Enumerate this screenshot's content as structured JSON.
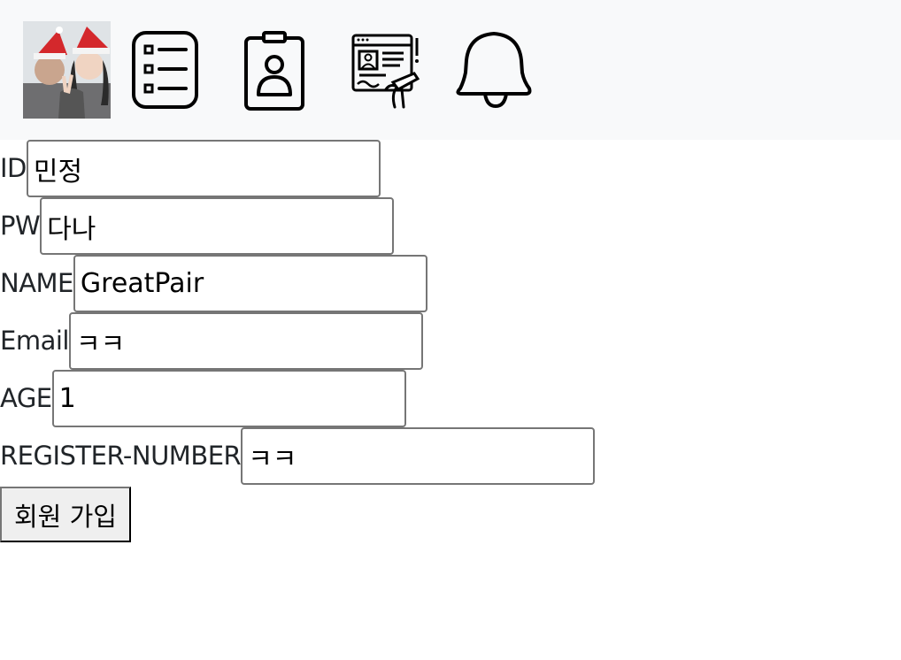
{
  "nav": {
    "items": [
      {
        "icon": "avatar-photo"
      },
      {
        "icon": "list-icon"
      },
      {
        "icon": "id-badge-icon"
      },
      {
        "icon": "register-form-icon"
      },
      {
        "icon": "bell-icon"
      }
    ]
  },
  "form": {
    "fields": [
      {
        "label": "ID",
        "value": "민정"
      },
      {
        "label": "PW",
        "value": "다나"
      },
      {
        "label": "NAME",
        "value": "GreatPair"
      },
      {
        "label": "Email",
        "value": "ㅋㅋ"
      },
      {
        "label": "AGE",
        "value": "1"
      },
      {
        "label": "REGISTER-NUMBER",
        "value": "ㅋㅋ"
      }
    ],
    "submit_label": "회원 가입"
  }
}
